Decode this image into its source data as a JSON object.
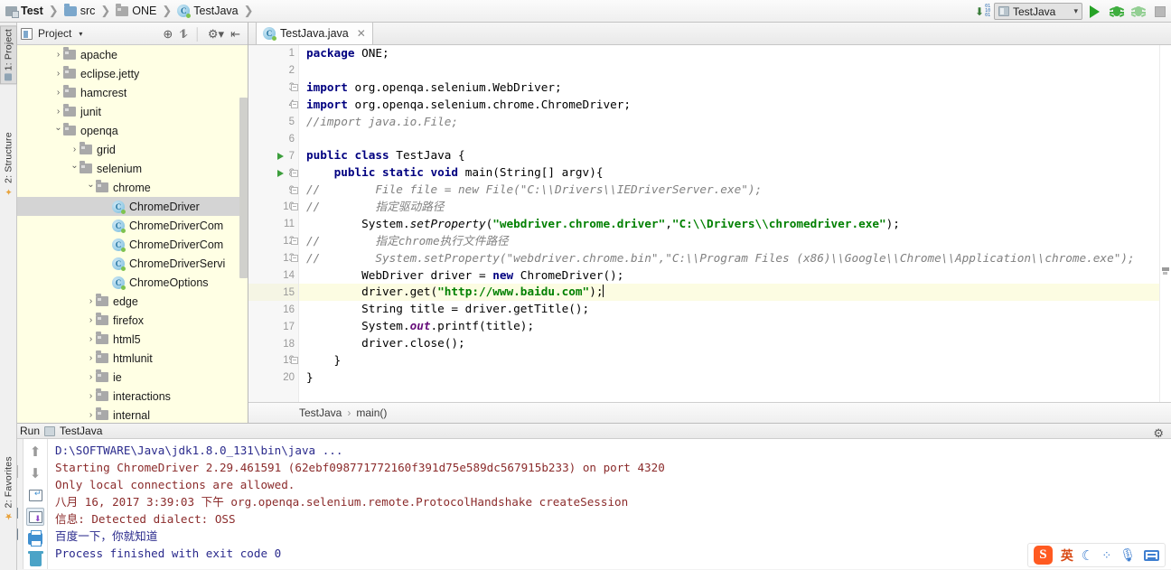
{
  "window": {
    "breadcrumbs": [
      {
        "label": "Test",
        "icon": "module-icon",
        "bold": true
      },
      {
        "label": "src",
        "icon": "source-folder-icon",
        "bold": false
      },
      {
        "label": "ONE",
        "icon": "package-icon",
        "bold": false
      },
      {
        "label": "TestJava",
        "icon": "java-class-icon",
        "bold": false
      }
    ]
  },
  "run_toolbar": {
    "sort_icon": "numeric-sort-icon",
    "config_name": "TestJava",
    "config_chevron": "chevron-down-icon",
    "run_button": "run-icon",
    "debug_button": "debug-icon",
    "coverage_button": "run-with-coverage-icon",
    "stop_button": "stop-icon"
  },
  "left_tabs": [
    {
      "label": "1: Project",
      "selected": true
    },
    {
      "label": "2: Structure",
      "selected": false
    }
  ],
  "bottom_left_tabs": [
    {
      "label": "2: Favorites",
      "selected": false
    }
  ],
  "project_panel": {
    "title": "Project",
    "caret": "chevron-down-icon",
    "toolbar_icons": [
      "locate-icon",
      "collapse-all-icon",
      "settings-icon",
      "hide-icon"
    ],
    "tree": [
      {
        "indent": 1,
        "twist": "closed",
        "icon": "package-icon",
        "label": "apache",
        "selected": false
      },
      {
        "indent": 1,
        "twist": "closed",
        "icon": "package-icon",
        "label": "eclipse.jetty",
        "selected": false
      },
      {
        "indent": 1,
        "twist": "closed",
        "icon": "package-icon",
        "label": "hamcrest",
        "selected": false
      },
      {
        "indent": 1,
        "twist": "closed",
        "icon": "package-icon",
        "label": "junit",
        "selected": false
      },
      {
        "indent": 1,
        "twist": "open",
        "icon": "package-icon",
        "label": "openqa",
        "selected": false
      },
      {
        "indent": 2,
        "twist": "closed",
        "icon": "package-icon",
        "label": "grid",
        "selected": false
      },
      {
        "indent": 2,
        "twist": "open",
        "icon": "package-icon",
        "label": "selenium",
        "selected": false
      },
      {
        "indent": 3,
        "twist": "open",
        "icon": "package-icon",
        "label": "chrome",
        "selected": false
      },
      {
        "indent": 4,
        "twist": "none",
        "icon": "java-class-icon",
        "label": "ChromeDriver",
        "selected": true
      },
      {
        "indent": 4,
        "twist": "none",
        "icon": "java-class-icon",
        "label": "ChromeDriverCom",
        "selected": false
      },
      {
        "indent": 4,
        "twist": "none",
        "icon": "java-class-icon",
        "label": "ChromeDriverCom",
        "selected": false
      },
      {
        "indent": 4,
        "twist": "none",
        "icon": "java-class-icon",
        "label": "ChromeDriverServi",
        "selected": false
      },
      {
        "indent": 4,
        "twist": "none",
        "icon": "java-class-icon",
        "label": "ChromeOptions",
        "selected": false
      },
      {
        "indent": 3,
        "twist": "closed",
        "icon": "package-icon",
        "label": "edge",
        "selected": false
      },
      {
        "indent": 3,
        "twist": "closed",
        "icon": "package-icon",
        "label": "firefox",
        "selected": false
      },
      {
        "indent": 3,
        "twist": "closed",
        "icon": "package-icon",
        "label": "html5",
        "selected": false
      },
      {
        "indent": 3,
        "twist": "closed",
        "icon": "package-icon",
        "label": "htmlunit",
        "selected": false
      },
      {
        "indent": 3,
        "twist": "closed",
        "icon": "package-icon",
        "label": "ie",
        "selected": false
      },
      {
        "indent": 3,
        "twist": "closed",
        "icon": "package-icon",
        "label": "interactions",
        "selected": false
      },
      {
        "indent": 3,
        "twist": "closed",
        "icon": "package-icon",
        "label": "internal",
        "selected": false
      }
    ]
  },
  "editor": {
    "tab": {
      "label": "TestJava.java",
      "icon": "java-class-icon",
      "close": "close-icon"
    },
    "breadcrumb": [
      "TestJava",
      "main()"
    ],
    "caret_line": 15,
    "lines": [
      {
        "n": 1,
        "run": false,
        "fold": "none",
        "hl": false,
        "tokens": [
          {
            "t": "package",
            "c": "kw"
          },
          {
            "t": " ONE;",
            "c": "pl"
          }
        ]
      },
      {
        "n": 2,
        "run": false,
        "fold": "none",
        "hl": false,
        "tokens": []
      },
      {
        "n": 3,
        "run": false,
        "fold": "fold",
        "hl": false,
        "tokens": [
          {
            "t": "import",
            "c": "kw"
          },
          {
            "t": " org.openqa.selenium.WebDriver;",
            "c": "pl"
          }
        ]
      },
      {
        "n": 4,
        "run": false,
        "fold": "fold",
        "hl": false,
        "tokens": [
          {
            "t": "import",
            "c": "kw"
          },
          {
            "t": " org.openqa.selenium.chrome.ChromeDriver;",
            "c": "pl"
          }
        ]
      },
      {
        "n": 5,
        "run": false,
        "fold": "none",
        "hl": false,
        "tokens": [
          {
            "t": "//import java.io.File;",
            "c": "cmt"
          }
        ]
      },
      {
        "n": 6,
        "run": false,
        "fold": "none",
        "hl": false,
        "tokens": []
      },
      {
        "n": 7,
        "run": true,
        "fold": "none",
        "hl": false,
        "tokens": [
          {
            "t": "public class",
            "c": "kw"
          },
          {
            "t": " TestJava {",
            "c": "pl"
          }
        ]
      },
      {
        "n": 8,
        "run": true,
        "fold": "fold",
        "hl": false,
        "tokens": [
          {
            "t": "    ",
            "c": "pl"
          },
          {
            "t": "public static void",
            "c": "kw"
          },
          {
            "t": " main(String[] argv){",
            "c": "pl"
          }
        ]
      },
      {
        "n": 9,
        "run": false,
        "fold": "fold",
        "hl": false,
        "tokens": [
          {
            "t": "//        File file = new File(\"C:\\\\Drivers\\\\IEDriverServer.exe\");",
            "c": "cmt"
          }
        ]
      },
      {
        "n": 10,
        "run": false,
        "fold": "fold",
        "hl": false,
        "tokens": [
          {
            "t": "//        指定驱动路径",
            "c": "cmt"
          }
        ]
      },
      {
        "n": 11,
        "run": false,
        "fold": "none",
        "hl": false,
        "tokens": [
          {
            "t": "        System.",
            "c": "pl"
          },
          {
            "t": "setProperty",
            "c": "mth"
          },
          {
            "t": "(",
            "c": "pl"
          },
          {
            "t": "\"webdriver.chrome.driver\"",
            "c": "str"
          },
          {
            "t": ",",
            "c": "pl"
          },
          {
            "t": "\"C:\\\\Drivers\\\\chromedriver.exe\"",
            "c": "str"
          },
          {
            "t": ");",
            "c": "pl"
          }
        ]
      },
      {
        "n": 12,
        "run": false,
        "fold": "fold",
        "hl": false,
        "tokens": [
          {
            "t": "//        指定chrome执行文件路径",
            "c": "cmt"
          }
        ]
      },
      {
        "n": 13,
        "run": false,
        "fold": "fold",
        "hl": false,
        "tokens": [
          {
            "t": "//        System.setProperty(\"webdriver.chrome.bin\",\"C:\\\\Program Files (x86)\\\\Google\\\\Chrome\\\\Application\\\\chrome.exe\");",
            "c": "cmt"
          }
        ]
      },
      {
        "n": 14,
        "run": false,
        "fold": "none",
        "hl": false,
        "tokens": [
          {
            "t": "        WebDriver driver = ",
            "c": "pl"
          },
          {
            "t": "new",
            "c": "kw"
          },
          {
            "t": " ChromeDriver();",
            "c": "pl"
          }
        ]
      },
      {
        "n": 15,
        "run": false,
        "fold": "none",
        "hl": true,
        "tokens": [
          {
            "t": "        driver.get(",
            "c": "pl"
          },
          {
            "t": "\"http://www.baidu.com\"",
            "c": "str"
          },
          {
            "t": ");",
            "c": "pl"
          }
        ]
      },
      {
        "n": 16,
        "run": false,
        "fold": "none",
        "hl": false,
        "tokens": [
          {
            "t": "        String title = driver.getTitle();",
            "c": "pl"
          }
        ]
      },
      {
        "n": 17,
        "run": false,
        "fold": "none",
        "hl": false,
        "tokens": [
          {
            "t": "        System.",
            "c": "pl"
          },
          {
            "t": "out",
            "c": "fld"
          },
          {
            "t": ".printf(title);",
            "c": "pl"
          }
        ]
      },
      {
        "n": 18,
        "run": false,
        "fold": "none",
        "hl": false,
        "tokens": [
          {
            "t": "        driver.close();",
            "c": "pl"
          }
        ]
      },
      {
        "n": 19,
        "run": false,
        "fold": "fold",
        "hl": false,
        "tokens": [
          {
            "t": "    }",
            "c": "pl"
          }
        ]
      },
      {
        "n": 20,
        "run": false,
        "fold": "none",
        "hl": false,
        "tokens": [
          {
            "t": "}",
            "c": "pl"
          }
        ]
      }
    ]
  },
  "run_panel": {
    "title": "Run",
    "config_name": "TestJava",
    "settings_icon": "gear-icon",
    "left_buttons": [
      "rerun-icon",
      "stop-icon",
      "pause-icon",
      "dump-threads-icon",
      "exit-icon"
    ],
    "right_buttons": [
      "up-arrow-icon",
      "down-arrow-icon",
      "soft-wrap-icon",
      "scroll-to-end-icon",
      "print-icon",
      "clear-all-icon"
    ],
    "console": [
      {
        "text": "D:\\SOFTWARE\\Java\\jdk1.8.0_131\\bin\\java ...",
        "style": "navy"
      },
      {
        "text": "Starting ChromeDriver 2.29.461591 (62ebf098771772160f391d75e589dc567915b233) on port 4320",
        "style": "red"
      },
      {
        "text": "Only local connections are allowed.",
        "style": "red"
      },
      {
        "text": "八月 16, 2017 3:39:03 下午 org.openqa.selenium.remote.ProtocolHandshake createSession",
        "style": "red"
      },
      {
        "text": "信息: Detected dialect: OSS",
        "style": "red"
      },
      {
        "text": "百度一下，你就知道",
        "style": "navy"
      },
      {
        "text": "Process finished with exit code 0",
        "style": "navy"
      }
    ]
  },
  "ime": {
    "logo": "S",
    "mode_label": "英",
    "moon_icon": "moon-icon",
    "dots_icon": "weather-icon",
    "mic_icon": "microphone-icon",
    "keyboard_icon": "keyboard-icon"
  },
  "colors": {
    "tree_bg": "#ffffe4",
    "selection": "#d4d4d4",
    "caret_line": "#fcfce2",
    "keyword": "#000080",
    "string": "#008000",
    "comment": "#808080",
    "console_navy": "#2a2a8c",
    "console_red": "#8b2b2b",
    "accent_green": "#27a327"
  }
}
